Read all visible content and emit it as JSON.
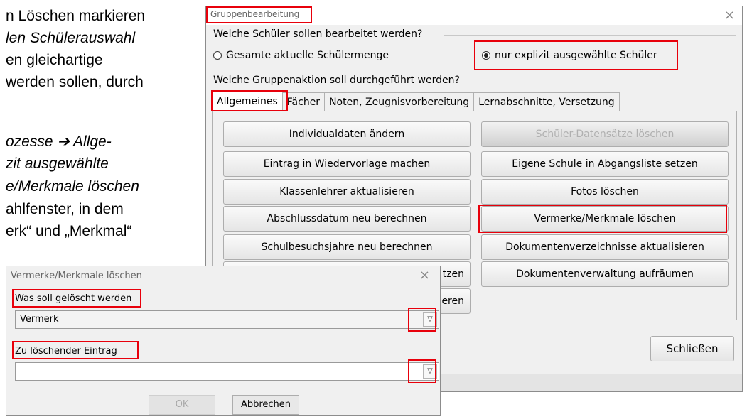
{
  "document": {
    "lines": [
      "n Löschen markieren",
      "len Schülerauswahl",
      "en gleichartige",
      "werden sollen, durch",
      "ozesse ➔ Allge-",
      "zit ausgewählte",
      "e/Merkmale löschen",
      "ahlfenster, in dem",
      "erk“ und „Merkmal“"
    ]
  },
  "group_dialog": {
    "title": "Gruppenbearbeitung",
    "close_glyph": "×",
    "question_students": "Welche Schüler sollen bearbeitet werden?",
    "radio_all": "Gesamte aktuelle Schülermenge",
    "radio_selected": "nur explizit ausgewählte Schüler",
    "radio_all_checked": false,
    "radio_selected_checked": true,
    "question_action": "Welche Gruppenaktion soll durchgeführt werden?",
    "tabs": [
      "Allgemeines",
      "Fächer",
      "Noten, Zeugnisvorbereitung",
      "Lernabschnitte, Versetzung"
    ],
    "active_tab": "Allgemeines",
    "left_buttons": [
      "Individualdaten ändern",
      "Eintrag in Wiedervorlage machen",
      "Klassenlehrer aktualisieren",
      "Abschlussdatum neu berechnen",
      "Schulbesuchsjahre neu berechnen",
      "tzen",
      "eren"
    ],
    "right_buttons": [
      "Schüler-Datensätze löschen",
      "Eigene Schule in Abgangsliste setzen",
      "Fotos löschen",
      "Vermerke/Merkmale löschen",
      "Dokumentenverzeichnisse aktualisieren",
      "Dokumentenverwaltung aufräumen"
    ],
    "close_button": "Schließen"
  },
  "delete_dialog": {
    "title": "Vermerke/Merkmale löschen",
    "close_glyph": "×",
    "what_label": "Was soll gelöscht werden",
    "what_value": "Vermerk",
    "entry_label": "Zu löschender Eintrag",
    "entry_value": "",
    "dropdown_glyph": "▽",
    "ok_button": "OK",
    "cancel_button": "Abbrechen"
  },
  "colors": {
    "highlight": "#e8000b",
    "dialog_bg": "#f0f0f0"
  }
}
